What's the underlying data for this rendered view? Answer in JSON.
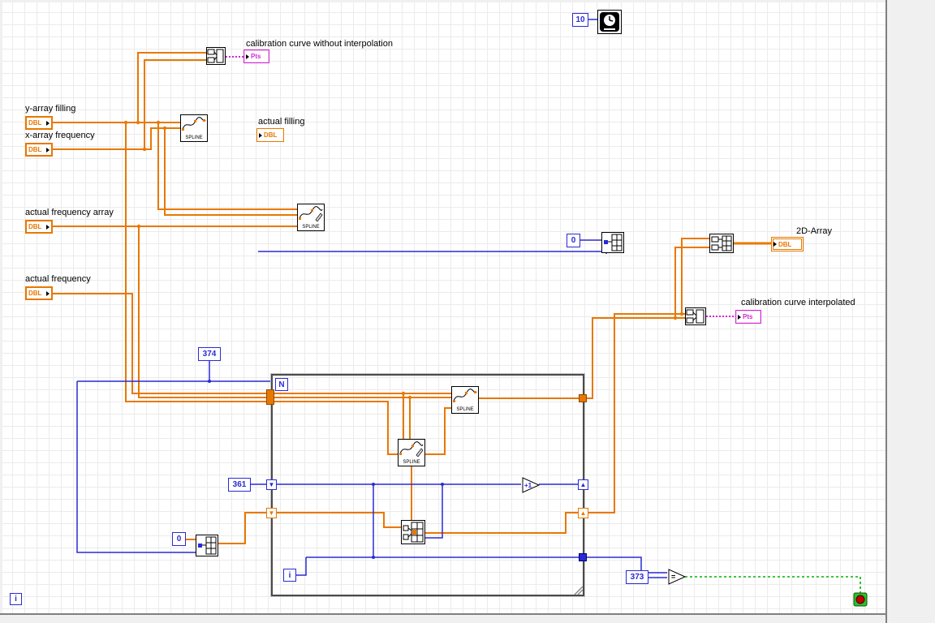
{
  "labels": {
    "calibration_without": "calibration curve without interpolation",
    "y_array_filling": "y-array filling",
    "x_array_frequency": "x-array frequency",
    "actual_filling": "actual filling",
    "actual_frequency_array": "actual frequency array",
    "actual_frequency": "actual frequency",
    "array_2d": "2D-Array",
    "calibration_interpolated": "calibration curve interpolated"
  },
  "constants": {
    "wait_ms": "10",
    "outer_count": "374",
    "col_init": "361",
    "index_zero_top": "0",
    "index_zero_bottom": "0",
    "compare_value": "373"
  },
  "terminals": {
    "dbl": "DBL",
    "pts": "Pts",
    "spline": "SPLINE",
    "loop_count": "N",
    "loop_iteration": "i",
    "increment": "+1",
    "equal": "="
  },
  "colors": {
    "dbl_wire": "#E87800",
    "int_wire": "#2A2AD4",
    "bool_wire": "#00B400",
    "cluster_wire": "#D02AD0"
  }
}
